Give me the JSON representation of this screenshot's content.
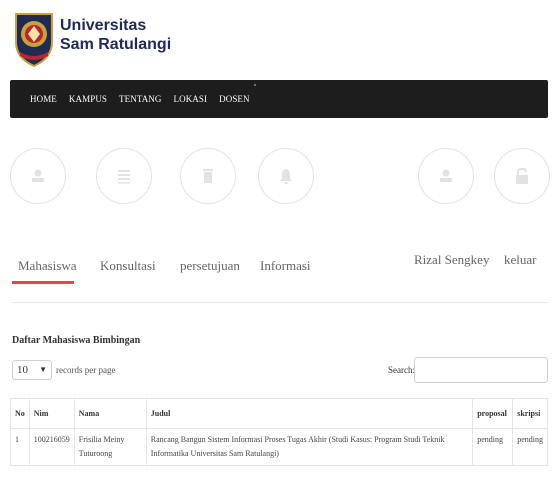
{
  "brand": {
    "line1": "Universitas",
    "line2": "Sam Ratulangi",
    "logo_icon": "university-seal-icon",
    "colors": {
      "navy": "#1f2a55",
      "gold": "#c9a13a",
      "red": "#b9262c"
    }
  },
  "nav": {
    "items": [
      "HOME",
      "KAMPUS",
      "TENTANG",
      "LOKASI",
      "DOSEN"
    ],
    "background": "#1d1d1d"
  },
  "tabs": [
    {
      "label": "Mahasiswa",
      "icon": "user-icon",
      "active": true
    },
    {
      "label": "Konsultasi",
      "icon": "list-icon",
      "active": false
    },
    {
      "label": "persetujuan",
      "icon": "trash-icon",
      "active": false
    },
    {
      "label": "Informasi",
      "icon": "bell-icon",
      "active": false
    },
    {
      "label": "Rizal Sengkey",
      "icon": "user-icon",
      "active": false
    },
    {
      "label": "keluar",
      "icon": "lock-icon",
      "active": false
    }
  ],
  "accent_color": "#e2494f",
  "section_title": "Daftar Mahasiswa Bimbingan",
  "table_controls": {
    "page_length": "10",
    "page_length_label": "records per page",
    "search_label": "Search:",
    "search_value": ""
  },
  "table": {
    "headers": [
      "No",
      "Nim",
      "Nama",
      "Judul",
      "proposal",
      "skripsi"
    ],
    "rows": [
      {
        "no": "1",
        "nim": "100216059",
        "nama": "Frisilia Meiny Tuturoong",
        "judul": "Rancang Bangun Sistem Informasi Proses Tugas Akhir (Studi Kasus: Program Studi Teknik Informatika Universitas Sam Ratulangi)",
        "proposal": "pending",
        "skripsi": "pending"
      }
    ]
  }
}
